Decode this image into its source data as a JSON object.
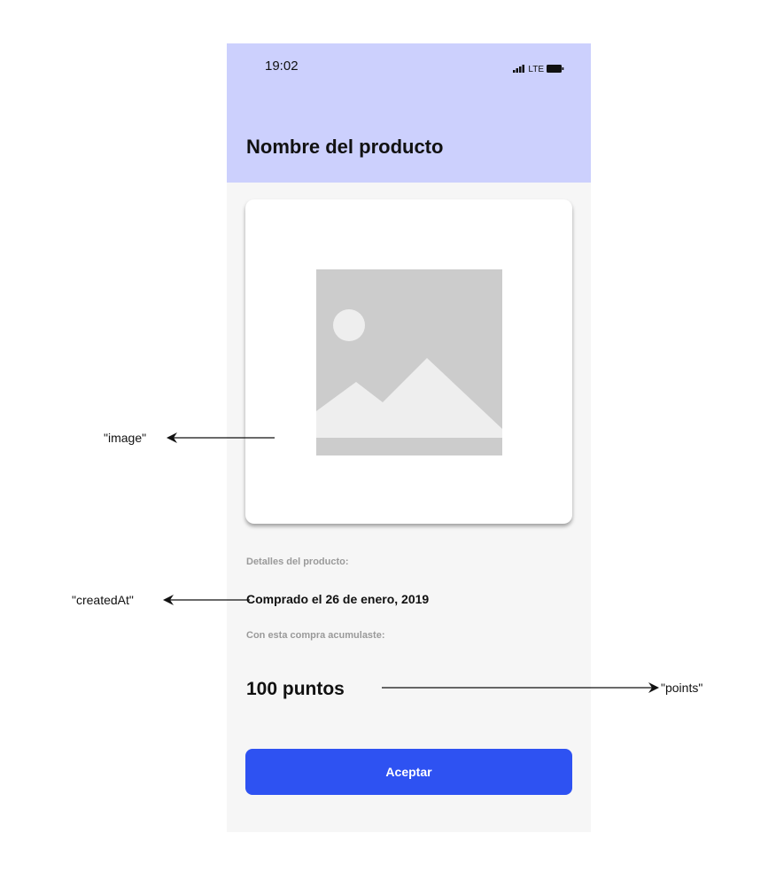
{
  "status_bar": {
    "time": "19:02",
    "network": "LTE",
    "icons": [
      "signal-icon",
      "battery-icon"
    ]
  },
  "header": {
    "title": "Nombre del producto",
    "background": "#ccd0fd"
  },
  "product_card": {
    "image_icon": "image-placeholder-icon"
  },
  "details": {
    "section_label": "Detalles del producto:",
    "purchase_date": "Comprado el 26 de enero, 2019",
    "accumulated_label": "Con esta compra acumulaste:",
    "points": "100 puntos"
  },
  "actions": {
    "accept_label": "Aceptar",
    "accept_color": "#2e52f2"
  },
  "annotations": {
    "image": "\"image\"",
    "created_at": "\"createdAt\"",
    "points": "\"points\""
  }
}
